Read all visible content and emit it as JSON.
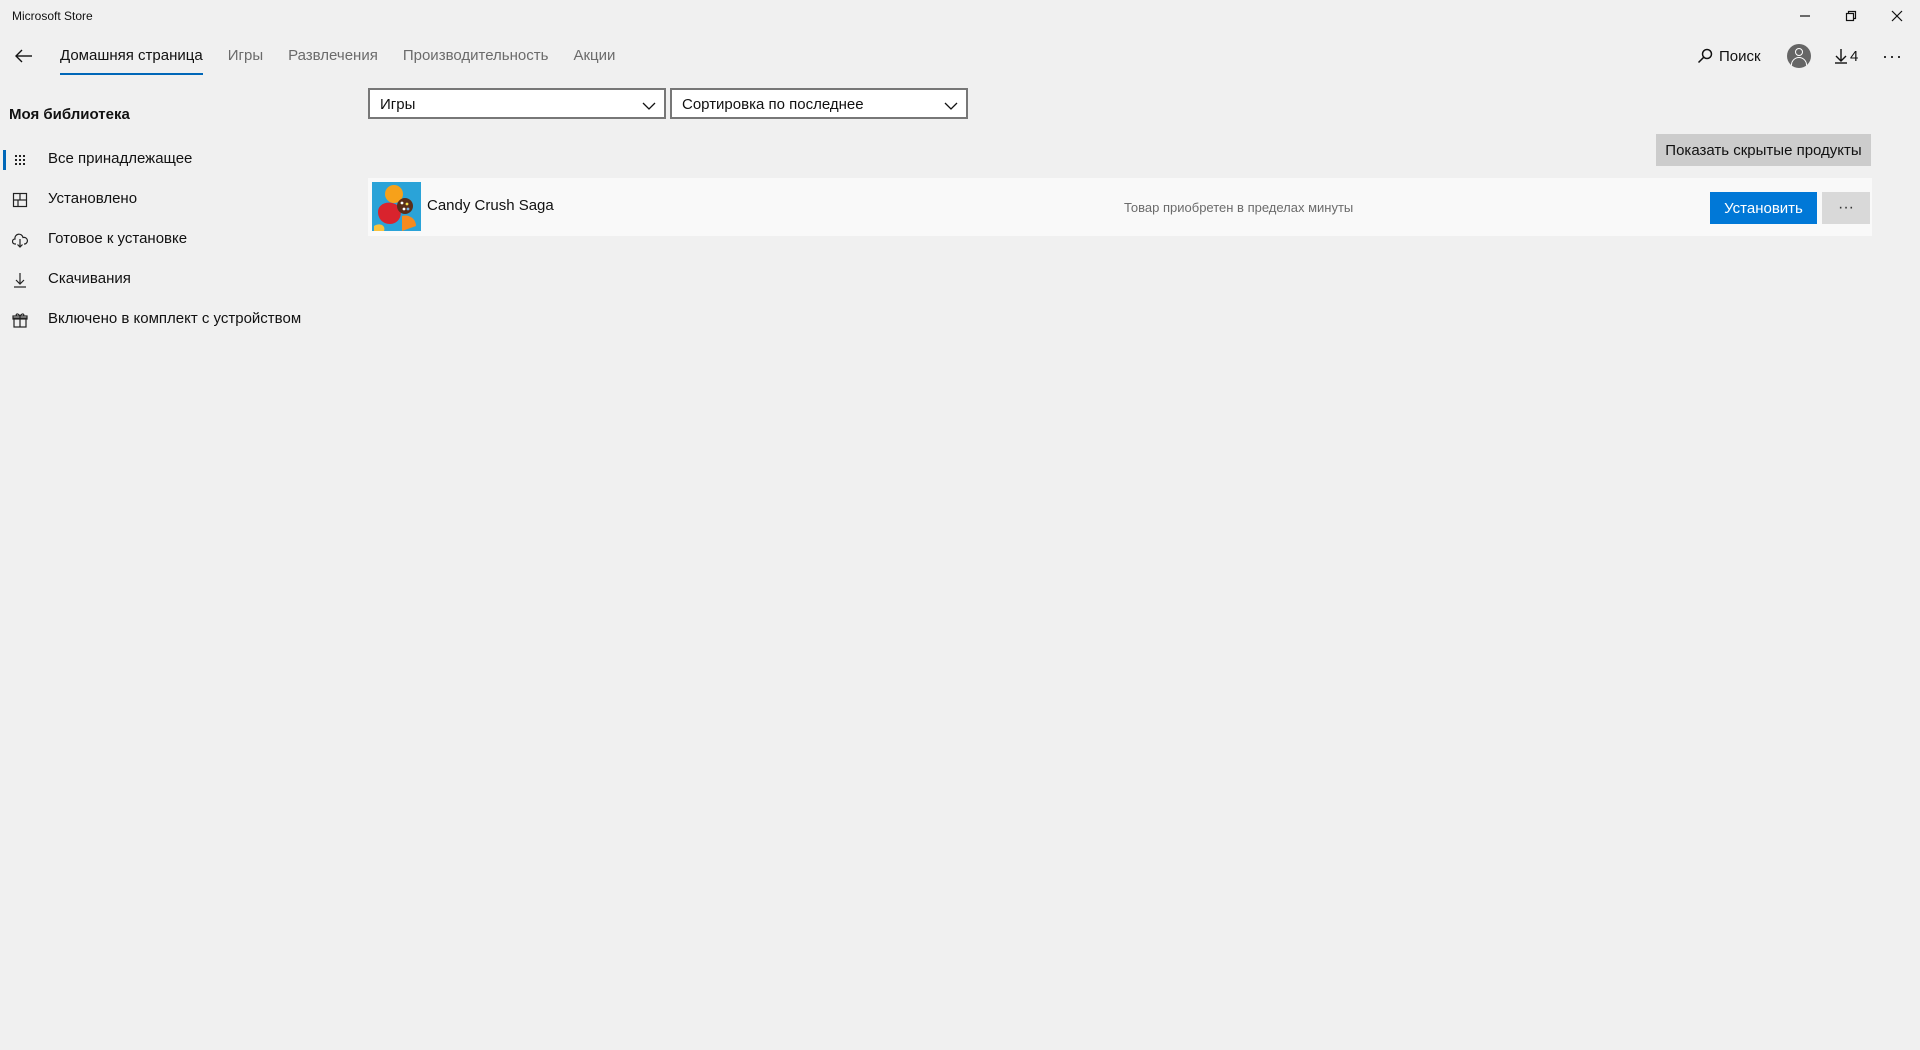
{
  "window": {
    "title": "Microsoft Store",
    "controls": [
      "minimize-icon",
      "restore-icon",
      "close-icon"
    ]
  },
  "nav": {
    "back_icon": "back-arrow-icon",
    "tabs": [
      {
        "label": "Домашняя страница",
        "active": true
      },
      {
        "label": "Игры",
        "active": false
      },
      {
        "label": "Развлечения",
        "active": false
      },
      {
        "label": "Производительность",
        "active": false
      },
      {
        "label": "Акции",
        "active": false
      }
    ],
    "search_label": "Поиск",
    "downloads_count": "4",
    "more_label": "···"
  },
  "sidebar": {
    "title": "Моя библиотека",
    "items": [
      {
        "label": "Все принадлежащее",
        "icon": "grid-dots-icon",
        "selected": true
      },
      {
        "label": "Установлено",
        "icon": "installed-grid-icon",
        "selected": false
      },
      {
        "label": "Готовое к установке",
        "icon": "cloud-download-icon",
        "selected": false
      },
      {
        "label": "Скачивания",
        "icon": "download-icon",
        "selected": false
      },
      {
        "label": "Включено в комплект с устройством",
        "icon": "gift-icon",
        "selected": false
      }
    ]
  },
  "filters": {
    "category": "Игры",
    "sort": "Сортировка по последнее"
  },
  "show_hidden_label": "Показать скрытые продукты",
  "products": [
    {
      "name": "Candy Crush Saga",
      "status": "Товар приобретен в пределах минуты",
      "install_label": "Установить",
      "more_label": "···"
    }
  ],
  "colors": {
    "accent": "#0067b8",
    "install_button": "#0078d7",
    "background": "#f0f0f0"
  }
}
